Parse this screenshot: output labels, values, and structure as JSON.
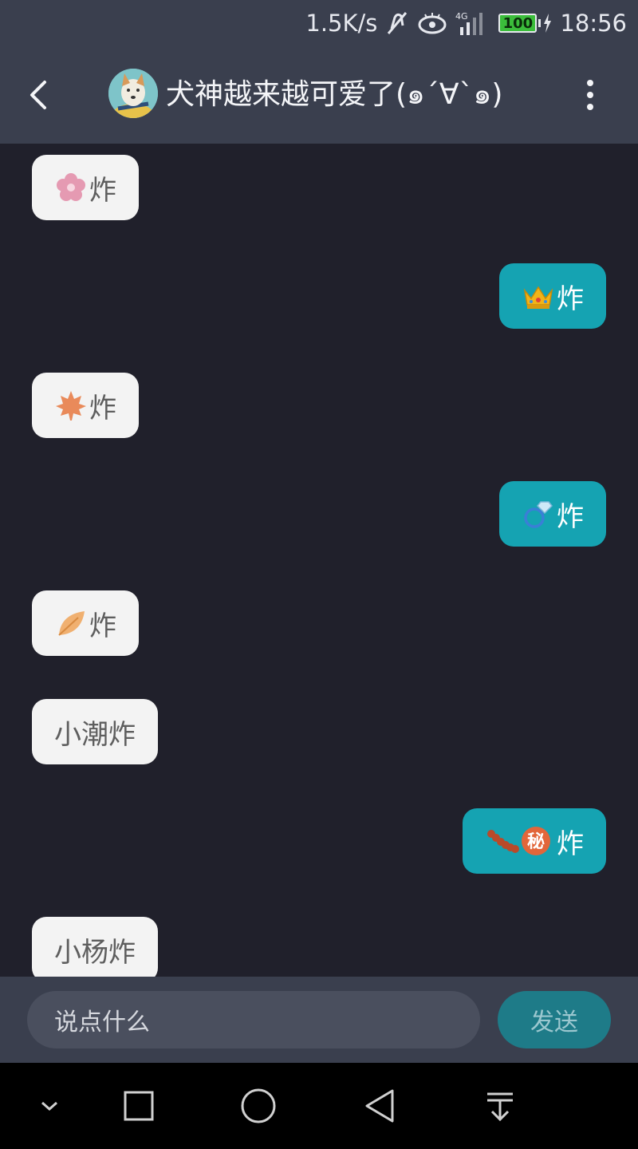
{
  "status_bar": {
    "net_speed": "1.5K/s",
    "network_type": "4G",
    "battery": "100",
    "time": "18:56"
  },
  "header": {
    "title": "犬神越来越可爱了(๑´∀`๑)"
  },
  "messages": [
    {
      "side": "in",
      "emoji": "flower-icon",
      "text": "炸"
    },
    {
      "side": "out",
      "emoji": "crown-icon",
      "text": "炸"
    },
    {
      "side": "in",
      "emoji": "maple-leaf-icon",
      "text": "炸"
    },
    {
      "side": "out",
      "emoji": "ring-icon",
      "text": "炸"
    },
    {
      "side": "in",
      "emoji": "leaf-icon",
      "text": "炸"
    },
    {
      "side": "in",
      "emoji": "",
      "text": "小潮炸"
    },
    {
      "side": "out",
      "emoji": "caterpillar-secret-icon",
      "text": "炸"
    },
    {
      "side": "in",
      "emoji": "",
      "text": "小杨炸"
    }
  ],
  "input": {
    "placeholder": "说点什么",
    "send_label": "发送"
  },
  "colors": {
    "header_bg": "#3a3f4e",
    "chat_bg": "#20202b",
    "incoming_bubble": "#f3f3f3",
    "outgoing_bubble": "#15a3b2",
    "send_button": "#1e7b88"
  }
}
